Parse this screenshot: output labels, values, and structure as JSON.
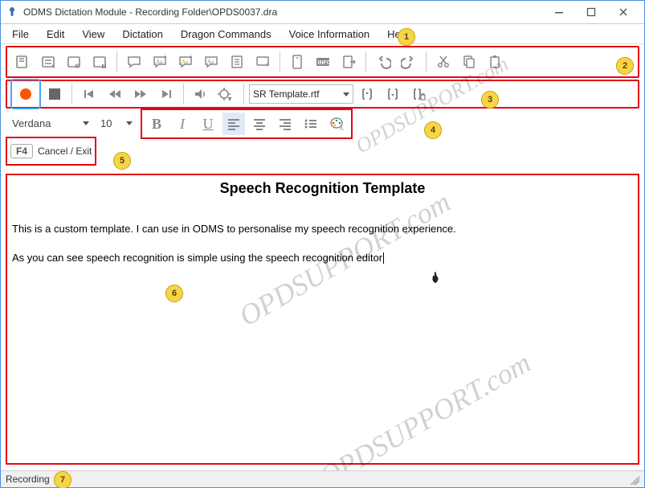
{
  "watermark_text": "OPDSUPPORT.com",
  "window": {
    "title": "ODMS Dictation Module - Recording Folder\\OPDS0037.dra"
  },
  "menu": {
    "items": [
      "File",
      "Edit",
      "View",
      "Dictation",
      "Dragon Commands",
      "Voice Information",
      "Help"
    ]
  },
  "toolbar2": {
    "icons": [
      "new-dictation-icon",
      "worktype-icon",
      "worktype-mic-icon",
      "worktype-pause-icon",
      "comment-icon",
      "comment-font-plus-icon",
      "comment-font-plus2-icon",
      "comment-font-size-icon",
      "insert-index-icon",
      "insert-voice-note-icon",
      "jobdata-icon",
      "info-box-icon",
      "export-icon",
      "undo-icon",
      "redo-icon",
      "cut-icon",
      "copy-icon",
      "paste-icon"
    ]
  },
  "toolbar3": {
    "icons": [
      "record-icon",
      "stop-icon",
      "skip-prev-icon",
      "rewind-icon",
      "fast-fwd-icon",
      "skip-next-icon",
      "volume-icon",
      "locate-icon"
    ],
    "template_combo": "SR Template.rtf",
    "right_icons": [
      "bracket-up-icon",
      "bracket-down-icon",
      "bracket-trash-icon"
    ]
  },
  "font_row": {
    "font_name": "Verdana",
    "font_size": "10",
    "bold": "B",
    "italic": "I",
    "underline": "U"
  },
  "cancel_row": {
    "key": "F4",
    "label": "Cancel / Exit"
  },
  "editor": {
    "heading": "Speech Recognition Template",
    "para1": "This is a custom template. I can use in ODMS to personalise my speech recognition experience.",
    "para2": "As you can see speech recognition is simple using the speech recognition editor"
  },
  "status": {
    "text": "Recording"
  },
  "annotations": {
    "b1": "1",
    "b2": "2",
    "b3": "3",
    "b4": "4",
    "b5": "5",
    "b6": "6",
    "b7": "7"
  }
}
